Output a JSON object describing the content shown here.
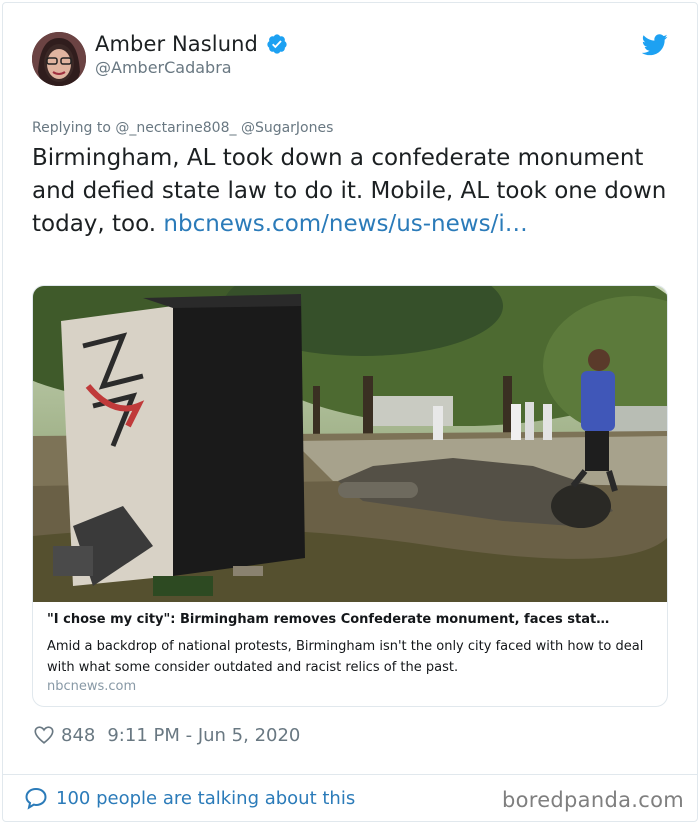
{
  "author": {
    "name": "Amber Naslund",
    "handle": "@AmberCadabra"
  },
  "reply": {
    "prefix": "Replying to",
    "mentions": "@_nectarine808_ @SugarJones"
  },
  "tweet": {
    "text": "Birmingham, AL took down a confederate monument and defied state law to do it. Mobile, AL took one down today, too. ",
    "link": "nbcnews.com/news/us-news/i…"
  },
  "link_card": {
    "title": "\"I chose my city\": Birmingham removes Confederate monument, faces stat…",
    "description": "Amid a backdrop of national protests, Birmingham isn't the only city faced with how to deal with what some consider outdated and racist relics of the past.",
    "domain": "nbcnews.com"
  },
  "meta": {
    "likes": "848",
    "timestamp": "9:11 PM - Jun 5, 2020"
  },
  "footer": {
    "talking": "100 people are talking about this",
    "watermark": "boredpanda.com"
  },
  "icons": {
    "verified": "verified-badge-icon",
    "bird": "twitter-bird-icon",
    "heart": "heart-icon",
    "bubble": "speech-bubble-icon"
  },
  "colors": {
    "link": "#2b7bb9",
    "verified": "#1da1f2",
    "muted": "#697882"
  }
}
